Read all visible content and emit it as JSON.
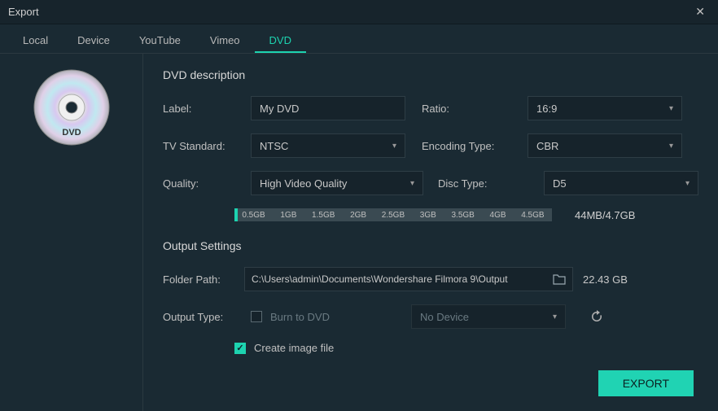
{
  "window": {
    "title": "Export"
  },
  "tabs": {
    "local": "Local",
    "device": "Device",
    "youtube": "YouTube",
    "vimeo": "Vimeo",
    "dvd": "DVD"
  },
  "sections": {
    "dvd_description": "DVD description",
    "output_settings": "Output Settings"
  },
  "labels": {
    "label": "Label:",
    "ratio": "Ratio:",
    "tv_standard": "TV Standard:",
    "encoding_type": "Encoding Type:",
    "quality": "Quality:",
    "disc_type": "Disc Type:",
    "folder_path": "Folder Path:",
    "output_type": "Output Type:",
    "burn_to_dvd": "Burn to DVD",
    "create_image": "Create image file"
  },
  "values": {
    "label": "My DVD",
    "ratio": "16:9",
    "tv_standard": "NTSC",
    "encoding_type": "CBR",
    "quality": "High Video Quality",
    "disc_type": "D5",
    "no_device": "No Device",
    "folder_path": "C:\\Users\\admin\\Documents\\Wondershare Filmora 9\\Output",
    "size_used": "44MB/4.7GB",
    "free_space": "22.43 GB"
  },
  "slider_ticks": [
    "0.5GB",
    "1GB",
    "1.5GB",
    "2GB",
    "2.5GB",
    "3GB",
    "3.5GB",
    "4GB",
    "4.5GB"
  ],
  "buttons": {
    "export": "EXPORT"
  }
}
